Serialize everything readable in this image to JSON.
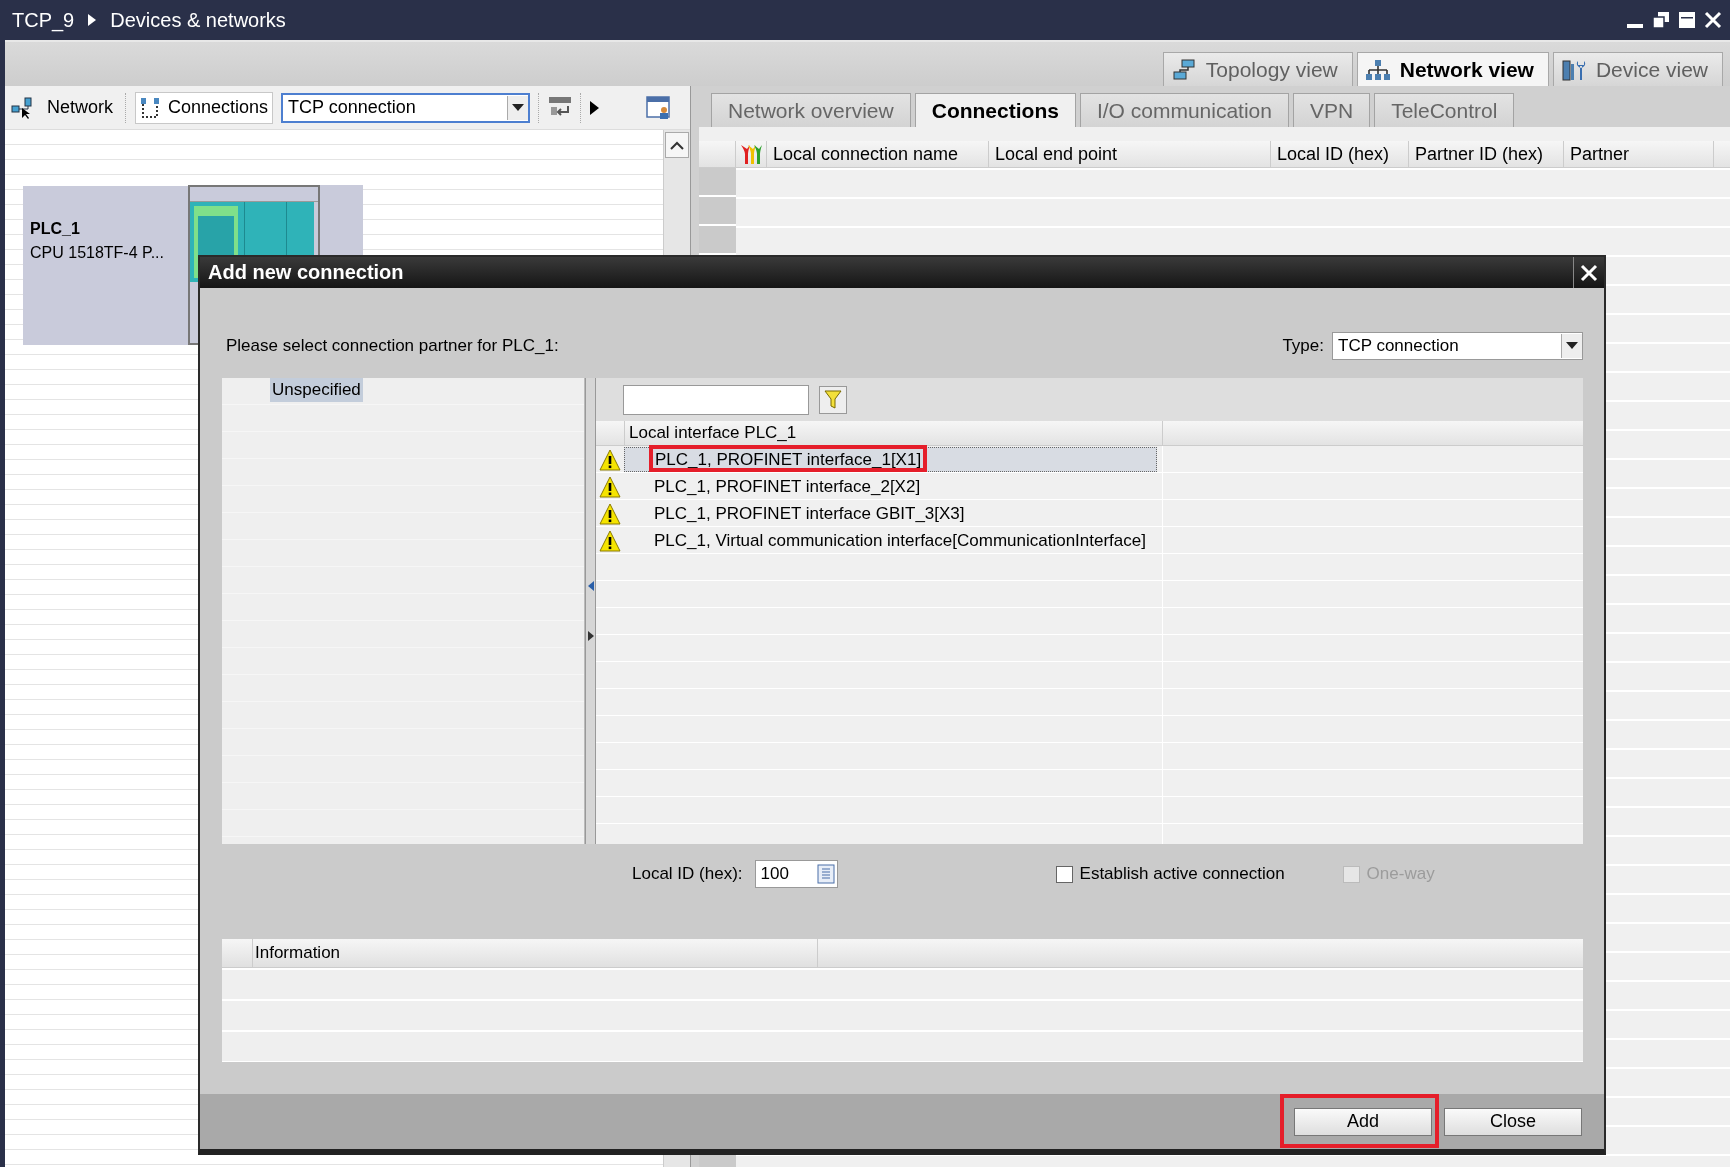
{
  "window": {
    "breadcrumb": [
      "TCP_9",
      "Devices & networks"
    ]
  },
  "view_tabs": [
    {
      "label": "Topology view",
      "kind": "topology",
      "selected": false
    },
    {
      "label": "Network view",
      "kind": "network",
      "selected": true
    },
    {
      "label": "Device view",
      "kind": "device",
      "selected": false
    }
  ],
  "toolbar": {
    "network": "Network",
    "connections": "Connections",
    "connection_type": "TCP connection"
  },
  "device": {
    "name": "PLC_1",
    "type": "CPU 1518TF-4 P..."
  },
  "editor_tabs": [
    {
      "label": "Network overview",
      "selected": false
    },
    {
      "label": "Connections",
      "selected": true
    },
    {
      "label": "I/O communication",
      "selected": false
    },
    {
      "label": "VPN",
      "selected": false
    },
    {
      "label": "TeleControl",
      "selected": false
    }
  ],
  "connections_table": {
    "columns": [
      "Local connection name",
      "Local end point",
      "Local ID (hex)",
      "Partner ID (hex)",
      "Partner"
    ]
  },
  "dialog": {
    "title": "Add new connection",
    "prompt": "Please select connection partner for PLC_1:",
    "type_label": "Type:",
    "type_value": "TCP connection",
    "tree": [
      {
        "label": "Unspecified",
        "selected": true
      }
    ],
    "list_header": "Local interface PLC_1",
    "interfaces": [
      {
        "label": "PLC_1, PROFINET interface_1[X1]",
        "warning": true,
        "selected": true,
        "highlighted": true
      },
      {
        "label": "PLC_1, PROFINET interface_2[X2]",
        "warning": true,
        "selected": false,
        "highlighted": false
      },
      {
        "label": "PLC_1, PROFINET interface GBIT_3[X3]",
        "warning": true,
        "selected": false,
        "highlighted": false
      },
      {
        "label": "PLC_1, Virtual communication interface[CommunicationInterface]",
        "warning": true,
        "selected": false,
        "highlighted": false
      }
    ],
    "local_id_label": "Local ID (hex):",
    "local_id": "100",
    "options": [
      {
        "label": "Establish active connection",
        "checked": false,
        "disabled": false
      },
      {
        "label": "One-way",
        "checked": false,
        "disabled": true
      }
    ],
    "info_header": "Information",
    "buttons": [
      {
        "label": "Add",
        "highlighted": true
      },
      {
        "label": "Close",
        "highlighted": false
      }
    ]
  }
}
